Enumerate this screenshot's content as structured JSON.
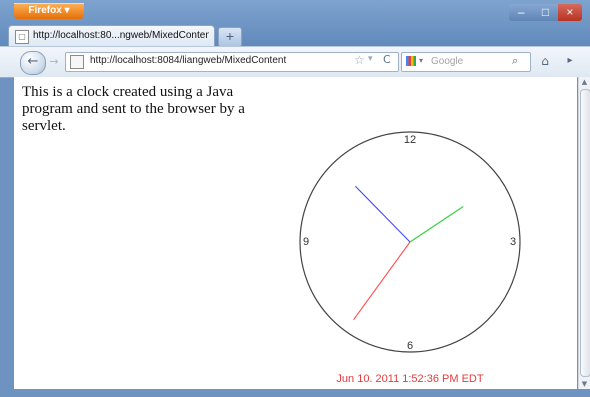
{
  "window": {
    "firefox_label": "Firefox ▾",
    "controls": [
      "‒",
      "□",
      "×"
    ]
  },
  "tab": {
    "title": "http://localhost:80...ngweb/MixedContent",
    "new_tab_symbol": "+",
    "favicon_symbol": "▢"
  },
  "nav": {
    "back_symbol": "←",
    "forward_symbol": "→",
    "url": "http://localhost:8084/liangweb/MixedContent",
    "bookmark_symbol": "☆",
    "dropdown_symbol": "▾",
    "reload_symbol": "C",
    "search_placeholder": "Google",
    "search_symbol": "⌕",
    "home_symbol": "⌂",
    "tools_symbol": "▸"
  },
  "page": {
    "description": "This is a clock created using a Java program and sent to the browser by a servlet.",
    "clock": {
      "label_12": "12",
      "label_3": "3",
      "label_6": "6",
      "label_9": "9",
      "timestamp": "Jun 10, 2011 1:52:36 PM EDT",
      "time": {
        "hour": 13,
        "minute": 52,
        "second": 36
      },
      "colors": {
        "second_hand": "#ff4b4b",
        "minute_hand": "#3f46ff",
        "hour_hand": "#31d43c",
        "timestamp": "#e53b3b"
      }
    }
  },
  "scrollbar": {
    "up_symbol": "▲",
    "down_symbol": "▼"
  }
}
